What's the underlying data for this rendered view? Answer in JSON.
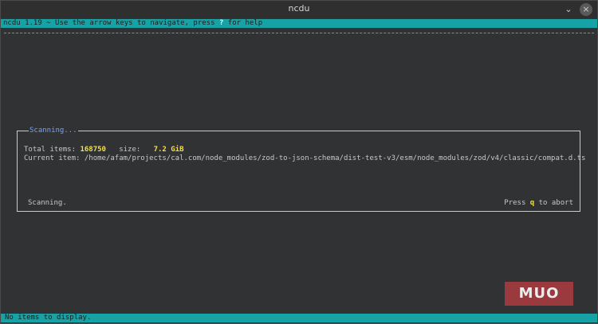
{
  "window": {
    "title": "ncdu",
    "minimize_label": "⌄",
    "close_label": "×"
  },
  "topbar": {
    "text_pre": "ncdu 1.19 ~ Use the arrow keys to navigate, press ",
    "help_key": "?",
    "text_post": " for help"
  },
  "dialog": {
    "title": "Scanning...",
    "total_items_label": "Total items: ",
    "total_items_value": "168750",
    "size_label": "   size:   ",
    "size_value": "7.2 GiB",
    "current_item_label": "Current item: ",
    "current_item_path": "/home/afam/projects/cal.com/node_modules/zod-to-json-schema/dist-test-v3/esm/node_modules/zod/v4/classic/compat.d.ts",
    "status": "Scanning.",
    "abort_pre": "Press ",
    "abort_key": "q",
    "abort_post": " to abort"
  },
  "bottombar": {
    "text": "No items to display."
  },
  "watermark": {
    "text": "MUO"
  }
}
